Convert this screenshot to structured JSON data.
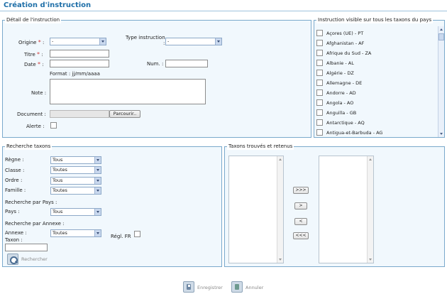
{
  "page": {
    "title": "Création d'instruction"
  },
  "detail": {
    "legend": "Détail de l'instruction",
    "origine_label": "Origine",
    "origine_value": "-",
    "type_label": "Type instruction",
    "type_suffix": ":",
    "type_value": "-",
    "titre_label": "Titre",
    "date_label": "Date",
    "num_label": "Num. :",
    "format_hint": "Format : jj/mm/aaaa",
    "note_label": "Note :",
    "document_label": "Document :",
    "browse_button": "Parcourir..",
    "alerte_label": "Alerte :",
    "colon": ":",
    "required_mark": "*"
  },
  "countries": {
    "legend": "Instruction visible sur tous les taxons du pays",
    "items": [
      "Açores (UE) - PT",
      "Afghanistan - AF",
      "Afrique du Sud - ZA",
      "Albanie - AL",
      "Algérie - DZ",
      "Allemagne - DE",
      "Andorre - AD",
      "Angola - AO",
      "Anguilla - GB",
      "Antarctique - AQ",
      "Antigua-et-Barbuda - AG"
    ]
  },
  "search": {
    "legend": "Recherche taxons",
    "regne_label": "Règne :",
    "regne_value": "Tous",
    "classe_label": "Classe :",
    "classe_value": "Toutes",
    "ordre_label": "Ordre :",
    "ordre_value": "Tous",
    "famille_label": "Famille :",
    "famille_value": "Toutes",
    "by_country_label": "Recherche par Pays :",
    "pays_label": "Pays :",
    "pays_value": "Tous",
    "by_annex_label": "Recherche par Annexe :",
    "annexe_label": "Annexe :",
    "annexe_value": "Toutes",
    "regl_label": "Régl. FR",
    "taxon_label": "Taxon :",
    "search_button": "Rechercher"
  },
  "taxa": {
    "legend": "Taxons trouvés et retenus",
    "add_all": ">>>",
    "add_one": ">",
    "remove_one": "<",
    "remove_all": "<<<"
  },
  "actions": {
    "save": "Enregistrer",
    "cancel": "Annuler"
  }
}
